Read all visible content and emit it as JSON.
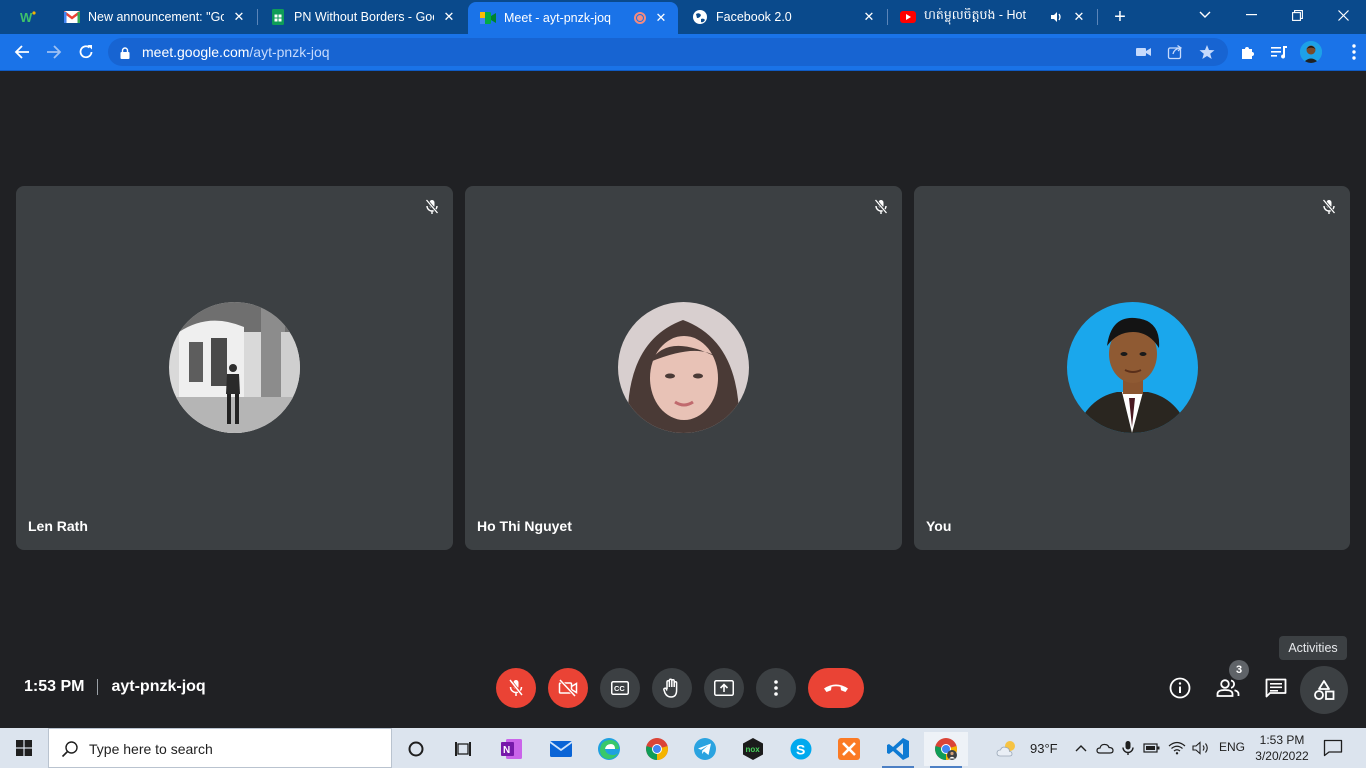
{
  "browser": {
    "tabs": [
      {
        "title": "New announcement: \"Good",
        "icon": "gmail-icon"
      },
      {
        "title": "PN Without Borders - Goog",
        "icon": "google-sheets-icon"
      },
      {
        "title": "Meet - ayt-pnzk-joq",
        "icon": "google-meet-icon",
        "active": true,
        "recording": true
      },
      {
        "title": "Facebook 2.0",
        "icon": "globe-icon"
      },
      {
        "title": "ហត់ម្លុលចិត្តបង - Hot",
        "icon": "youtube-icon",
        "audio": true
      }
    ],
    "pinned_icon": "wps-icon",
    "address": {
      "host": "meet.google.com",
      "path": "/ayt-pnzk-joq"
    }
  },
  "meet": {
    "participants": [
      {
        "name": "Len Rath",
        "muted": true,
        "avatar": "photo-woman-standing"
      },
      {
        "name": "Ho Thi Nguyet",
        "muted": true,
        "avatar": "photo-woman-portrait"
      },
      {
        "name": "You",
        "muted": true,
        "avatar": "photo-man-suit"
      }
    ],
    "time": "1:53 PM",
    "meeting_code": "ayt-pnzk-joq",
    "participant_count": "3",
    "tooltip": "Activities",
    "controls": [
      "mic-off-icon",
      "camera-off-icon",
      "captions-icon",
      "raise-hand-icon",
      "present-icon",
      "more-options-icon",
      "hang-up-icon"
    ],
    "colors": {
      "danger": "#ea4335",
      "tile": "#3c4043",
      "background": "#202124"
    }
  },
  "taskbar": {
    "search_placeholder": "Type here to search",
    "weather": "93°F",
    "language": "ENG",
    "time": "1:53 PM",
    "date": "3/20/2022"
  }
}
